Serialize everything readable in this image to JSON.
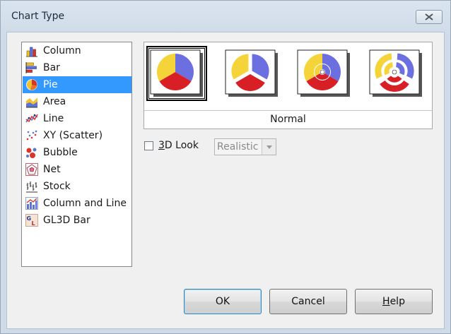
{
  "window": {
    "title": "Chart Type"
  },
  "chart_types": [
    {
      "label": "Column",
      "icon": "column-chart-icon",
      "selected": false
    },
    {
      "label": "Bar",
      "icon": "bar-chart-icon",
      "selected": false
    },
    {
      "label": "Pie",
      "icon": "pie-chart-icon",
      "selected": true
    },
    {
      "label": "Area",
      "icon": "area-chart-icon",
      "selected": false
    },
    {
      "label": "Line",
      "icon": "line-chart-icon",
      "selected": false
    },
    {
      "label": "XY (Scatter)",
      "icon": "scatter-chart-icon",
      "selected": false
    },
    {
      "label": "Bubble",
      "icon": "bubble-chart-icon",
      "selected": false
    },
    {
      "label": "Net",
      "icon": "net-chart-icon",
      "selected": false
    },
    {
      "label": "Stock",
      "icon": "stock-chart-icon",
      "selected": false
    },
    {
      "label": "Column and Line",
      "icon": "column-and-line-chart-icon",
      "selected": false
    },
    {
      "label": "GL3D Bar",
      "icon": "gl3d-bar-chart-icon",
      "selected": false
    }
  ],
  "variants": [
    {
      "icon": "pie-normal-icon",
      "selected": true
    },
    {
      "icon": "pie-exploded-icon",
      "selected": false
    },
    {
      "icon": "donut-icon",
      "selected": false
    },
    {
      "icon": "donut-exploded-icon",
      "selected": false
    }
  ],
  "variant_caption": "Normal",
  "look": {
    "checkbox_label_mnemonic": "3",
    "checkbox_label_rest": "D Look",
    "checked": false,
    "select_value": "Realistic"
  },
  "buttons": {
    "ok": "OK",
    "cancel": "Cancel",
    "help_mnemonic": "H",
    "help_rest": "elp"
  },
  "colors": {
    "selection": "#3399ff",
    "pie_yellow": "#f5d43a",
    "pie_blue": "#6b6fe0",
    "pie_red": "#d91f26"
  }
}
